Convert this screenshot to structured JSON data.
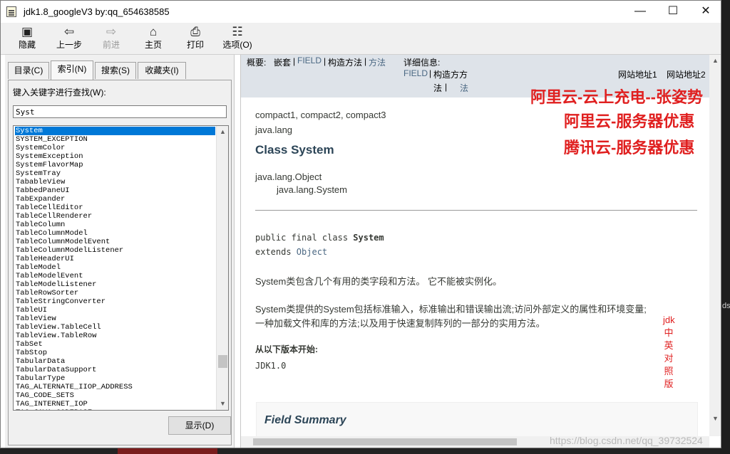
{
  "window": {
    "title": "jdk1.8_googleV3 by:qq_654638585",
    "controls": {
      "minimize": "—",
      "maximize": "☐",
      "close": "✕"
    }
  },
  "toolbar": [
    {
      "label": "隐藏",
      "icon": "hide-icon",
      "glyph": "▣",
      "enabled": true
    },
    {
      "label": "上一步",
      "icon": "back-arrow-icon",
      "glyph": "⇦",
      "enabled": true
    },
    {
      "label": "前进",
      "icon": "forward-arrow-icon",
      "glyph": "⇨",
      "enabled": false
    },
    {
      "label": "主页",
      "icon": "home-icon",
      "glyph": "⌂",
      "enabled": true
    },
    {
      "label": "打印",
      "icon": "printer-icon",
      "glyph": "⎙",
      "enabled": true
    },
    {
      "label": "选项(O)",
      "icon": "options-icon",
      "glyph": "☷",
      "enabled": true
    }
  ],
  "left": {
    "tabs": [
      "目录(C)",
      "索引(N)",
      "搜索(S)",
      "收藏夹(I)"
    ],
    "active_tab": "索引(N)",
    "keyword_label": "键入关键字进行查找(W):",
    "keyword_value": "Syst",
    "index_items": [
      "System",
      "SYSTEM_EXCEPTION",
      "SystemColor",
      "SystemException",
      "SystemFlavorMap",
      "SystemTray",
      "TabableView",
      "TabbedPaneUI",
      "TabExpander",
      "TableCellEditor",
      "TableCellRenderer",
      "TableColumn",
      "TableColumnModel",
      "TableColumnModelEvent",
      "TableColumnModelListener",
      "TableHeaderUI",
      "TableModel",
      "TableModelEvent",
      "TableModelListener",
      "TableRowSorter",
      "TableStringConverter",
      "TableUI",
      "TableView",
      "TableView.TableCell",
      "TableView.TableRow",
      "TabSet",
      "TabStop",
      "TabularData",
      "TabularDataSupport",
      "TabularType",
      "TAG_ALTERNATE_IIOP_ADDRESS",
      "TAG_CODE_SETS",
      "TAG_INTERNET_IOP",
      "TAG_JAVA_CODEBASE"
    ],
    "selected_item": "System",
    "show_button": "显示(D)"
  },
  "right": {
    "nav": {
      "summary_label": "概要:",
      "summary_nested": "嵌套",
      "summary_field": "FIELD",
      "summary_constr": "构造方法",
      "summary_method": "方法",
      "detail_label": "详细信息:",
      "detail_field": "FIELD",
      "detail_constr_a": "构造方方",
      "detail_constr_b": "法",
      "detail_method": "法",
      "site1": "网站地址1",
      "site2": "网站地址2"
    },
    "ads": [
      "阿里云-云上充电--张姿势",
      "阿里云-服务器优惠",
      "腾讯云-服务器优惠"
    ],
    "profiles": "compact1, compact2, compact3",
    "package": "java.lang",
    "class_title": "Class System",
    "inherit_parent": "java.lang.Object",
    "inherit_child": "java.lang.System",
    "decl_line1": "public final class ",
    "decl_name": "System",
    "decl_extends": "extends ",
    "decl_object": "Object",
    "desc1": "System类包含几个有用的类字段和方法。 它不能被实例化。",
    "desc2_line1": "System类提供的System包括标准输入，标准输出和错误输出流;访问外部定义的属性和环境变量;",
    "desc2_line2": "一种加载文件和库的方法;以及用于快速复制阵列的一部分的实用方法。",
    "since_label": "从以下版本开始:",
    "since_value": "JDK1.0",
    "vertical_note": [
      "jdk",
      "中",
      "英",
      "对",
      "照",
      "版"
    ],
    "field_summary": "Field Summary"
  },
  "watermark": "https://blog.csdn.net/qq_39732524",
  "desktop_fragment": "ds"
}
